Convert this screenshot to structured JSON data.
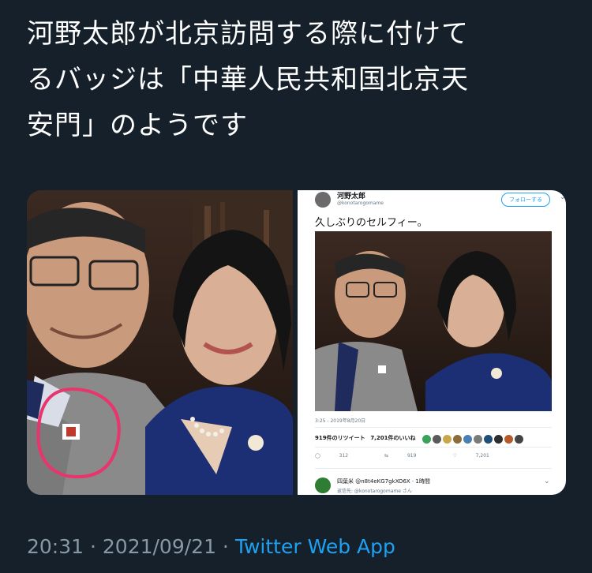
{
  "tweet": {
    "text_line1": "河野太郎が北京訪問する際に付けて",
    "text_line2": "るバッジは「中華人民共和国北京天",
    "text_line3": "安門」のようです"
  },
  "embedded_tweet": {
    "author_name": "河野太郎",
    "author_handle": "@konotarogomame",
    "follow_label": "フォローする",
    "text": "久しぶりのセルフィー。",
    "timestamp": "3:25 - 2019年8月20日",
    "retweets_label": "919件のリツイート",
    "likes_label": "7,201件のいいね",
    "reply_count": "312",
    "retweet_count": "919",
    "like_count": "7,201",
    "reply_author": "四葉米 @n8t4eKG7gkXO6X · 1時間",
    "reply_to": "返信先: @konotarogomame さん",
    "liker_colors": [
      "#3aa35b",
      "#5a5a5a",
      "#caa64a",
      "#8a6d3b",
      "#4a7fb5",
      "#7a7a7a",
      "#1f4e79",
      "#2d2d2d",
      "#b55a2a",
      "#444444"
    ]
  },
  "meta": {
    "time": "20:31",
    "separator1": " · ",
    "date": "2021/09/21",
    "separator2": " · ",
    "source": "Twitter Web App"
  },
  "colors": {
    "background": "#15202b",
    "link": "#1da1f2",
    "secondary_text": "#8899a6",
    "annotation_circle": "#e8356d"
  }
}
